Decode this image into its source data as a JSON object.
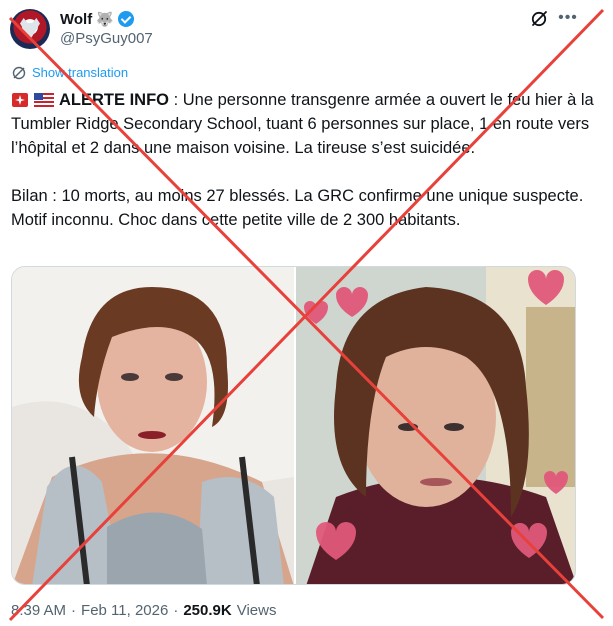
{
  "author": {
    "display_name": "Wolf",
    "name_emoji": "🐺",
    "handle": "@PsyGuy007"
  },
  "translation": {
    "label": "Show translation"
  },
  "tweet": {
    "alert_label": "ALERTE INFO",
    "paragraph1_rest": " : Une personne transgenre armée a ouvert le feu hier à la Tumbler Ridge Secondary School, tuant 6 personnes sur place, 1 en route vers l’hôpital et 2 dans une maison voisine. La tireuse s’est suicidée.",
    "paragraph2": "Bilan : 10 morts, au moins 27 blessés. La GRC confirme une unique suspecte. Motif inconnu. Choc dans cette petite ville de 2 300 habitants."
  },
  "meta": {
    "time": "8:39 AM",
    "separator": "·",
    "date": "Feb 11, 2026",
    "views_count": "250.9K",
    "views_label": "Views"
  },
  "colors": {
    "accent": "#1d9bf0",
    "cross": "#e8403a",
    "text": "#0f1419",
    "muted": "#536471"
  },
  "icons": [
    "wolf-avatar-icon",
    "verified-badge-icon",
    "grok-icon",
    "more-options-icon",
    "globe-icon",
    "rotating-light-icon",
    "us-flag-icon"
  ]
}
